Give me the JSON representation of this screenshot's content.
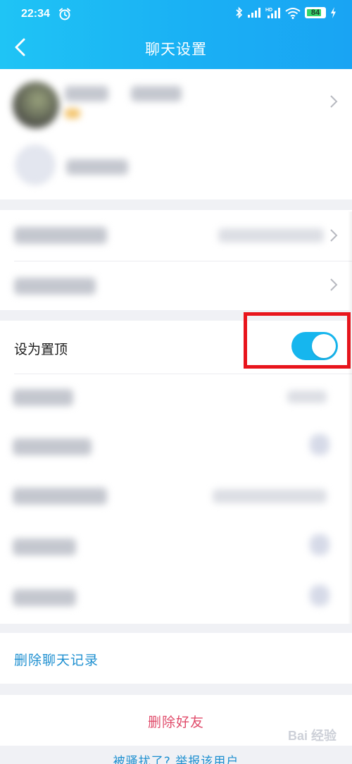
{
  "status_bar": {
    "time": "22:34",
    "battery_level": "84",
    "battery_fraction": 0.84,
    "icons": [
      "alarm-icon",
      "bluetooth-icon",
      "signal-icon",
      "hd-signal-icon",
      "wifi-icon",
      "battery-icon",
      "charging-icon"
    ]
  },
  "nav": {
    "back_icon": "chevron-left-icon",
    "title": "聊天设置"
  },
  "settings": {
    "pin_to_top_label": "设为置顶",
    "pin_to_top_enabled": true
  },
  "actions": {
    "delete_chat_history": "删除聊天记录",
    "delete_friend": "删除好友",
    "report_link": "被骚扰了? 举报该用户"
  },
  "watermark": "Bai 经验",
  "colors": {
    "header_gradient_start": "#1fc4f5",
    "header_gradient_end": "#19a4f3",
    "toggle_on": "#16b6ee",
    "link_blue": "#1d8fd0",
    "danger_red": "#e04b6a",
    "highlight_red": "#e8141c"
  }
}
